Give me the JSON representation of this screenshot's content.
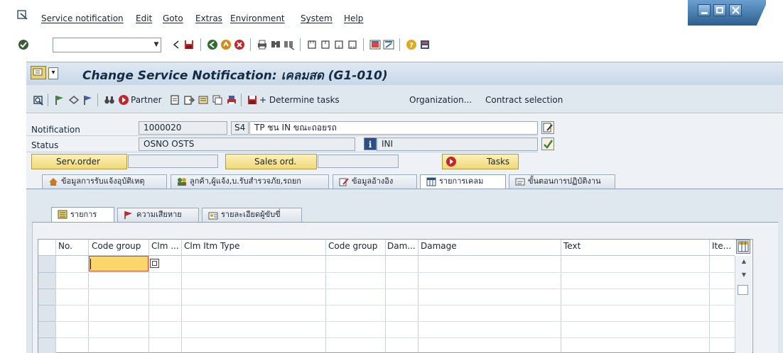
{
  "menu": [
    "Service notification",
    "Edit",
    "Goto",
    "Extras",
    "Environment",
    "System",
    "Help"
  ],
  "okcode": {
    "value": ""
  },
  "title": "Change Service Notification: เคลมสด (G1-010)",
  "app_toolbar": {
    "partner": "Partner",
    "determine_tasks": "+ Determine tasks",
    "organization": "Organization...",
    "contract_selection": "Contract selection"
  },
  "header": {
    "notification_label": "Notification",
    "notification_value": "1000020",
    "notif_type": "S4",
    "notif_desc": "TP ชน IN ขณะถอยรถ",
    "status_label": "Status",
    "status_value": "OSNO OSTS",
    "status_short": "INI",
    "serv_order_btn": "Serv.order",
    "sales_ord_btn": "Sales ord.",
    "tasks_btn": "Tasks"
  },
  "tabs": [
    {
      "label": "ข้อมูลการรับแจ้งอุบัติเหตุ",
      "active": false
    },
    {
      "label": "ลูกค้า,ผู้แจ้ง,บ.รับสำรวจภัย,รถยก",
      "active": false
    },
    {
      "label": "ข้อมูลอ้างอิง",
      "active": false
    },
    {
      "label": "รายการเคลม",
      "active": true
    },
    {
      "label": "ขั้นตอนการปฏิบัติงาน",
      "active": false
    }
  ],
  "subtabs": [
    {
      "label": "รายการ",
      "active": true
    },
    {
      "label": "ความเสียหาย",
      "active": false
    },
    {
      "label": "รายละเอียดผู้ขับขี่",
      "active": false
    }
  ],
  "table": {
    "columns": [
      "No.",
      "Code group",
      "Clm ...",
      "Clm Itm Type",
      "Code group",
      "Dam...",
      "Damage",
      "Text",
      "Ite..."
    ]
  },
  "colors": {
    "title_bg": "#c7d7e7",
    "toolbar_bg": "#dfe7ef",
    "button_yellow": "#f1d97a",
    "active_cell": "#fbd66b"
  }
}
